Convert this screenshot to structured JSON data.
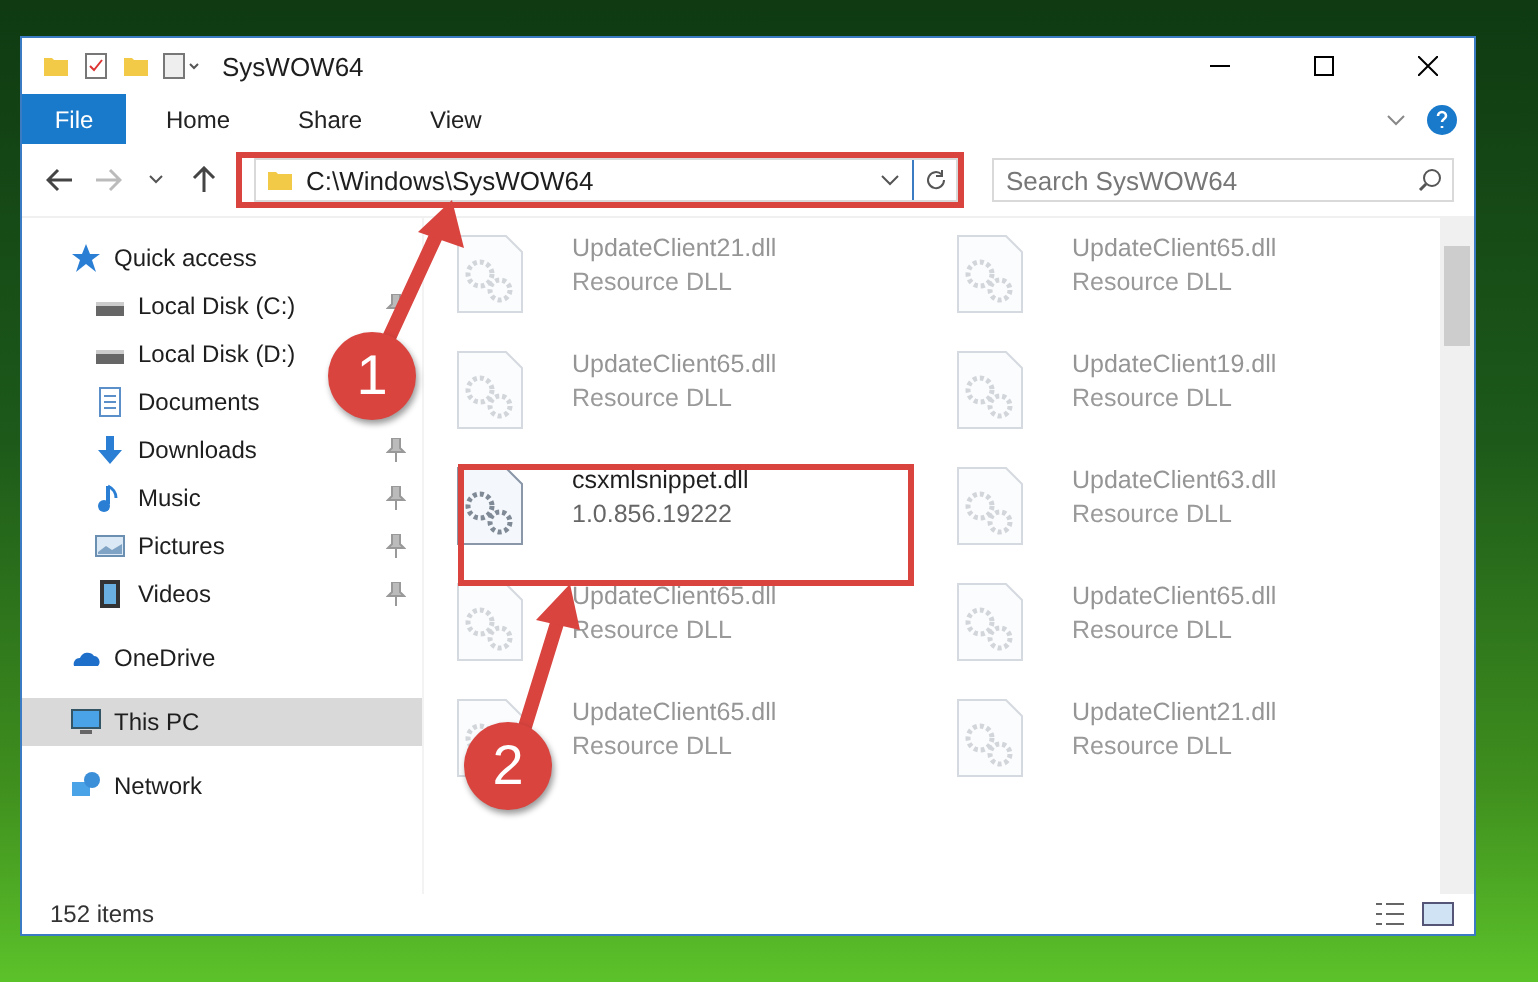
{
  "window": {
    "title": "SysWOW64"
  },
  "ribbon_tabs": [
    {
      "label": "File",
      "selected": true
    },
    {
      "label": "Home",
      "selected": false
    },
    {
      "label": "Share",
      "selected": false
    },
    {
      "label": "View",
      "selected": false
    }
  ],
  "address": {
    "path": "C:\\Windows\\SysWOW64"
  },
  "search": {
    "placeholder": "Search SysWOW64"
  },
  "sidebar": {
    "items": [
      {
        "label": "Quick access",
        "kind": "star",
        "selected": false,
        "children": [
          {
            "label": "Local Disk (C:)",
            "kind": "drive",
            "pinned": true
          },
          {
            "label": "Local Disk (D:)",
            "kind": "drive",
            "pinned": false
          },
          {
            "label": "Documents",
            "kind": "document",
            "pinned": false
          },
          {
            "label": "Downloads",
            "kind": "download",
            "pinned": true
          },
          {
            "label": "Music",
            "kind": "music",
            "pinned": true
          },
          {
            "label": "Pictures",
            "kind": "picture",
            "pinned": true
          },
          {
            "label": "Videos",
            "kind": "video",
            "pinned": true
          }
        ]
      },
      {
        "label": "OneDrive",
        "kind": "cloud",
        "selected": false
      },
      {
        "label": "This PC",
        "kind": "pc",
        "selected": true
      },
      {
        "label": "Network",
        "kind": "network",
        "selected": false
      }
    ]
  },
  "files": [
    {
      "name": "UpdateClient21.dll",
      "detail": "Resource DLL",
      "dimmed": true
    },
    {
      "name": "UpdateClient65.dll",
      "detail": "Resource DLL",
      "dimmed": true
    },
    {
      "name": "UpdateClient65.dll",
      "detail": "Resource DLL",
      "dimmed": true
    },
    {
      "name": "UpdateClient19.dll",
      "detail": "Resource DLL",
      "dimmed": true
    },
    {
      "name": "csxmlsnippet.dll",
      "detail": "1.0.856.19222",
      "dimmed": false
    },
    {
      "name": "UpdateClient63.dll",
      "detail": "Resource DLL",
      "dimmed": true
    },
    {
      "name": "UpdateClient65.dll",
      "detail": "Resource DLL",
      "dimmed": true
    },
    {
      "name": "UpdateClient65.dll",
      "detail": "Resource DLL",
      "dimmed": true
    },
    {
      "name": "UpdateClient65.dll",
      "detail": "Resource DLL",
      "dimmed": true
    },
    {
      "name": "UpdateClient21.dll",
      "detail": "Resource DLL",
      "dimmed": true
    }
  ],
  "status_bar": {
    "count": "152 items"
  },
  "callouts": [
    {
      "number": "1"
    },
    {
      "number": "2"
    }
  ]
}
